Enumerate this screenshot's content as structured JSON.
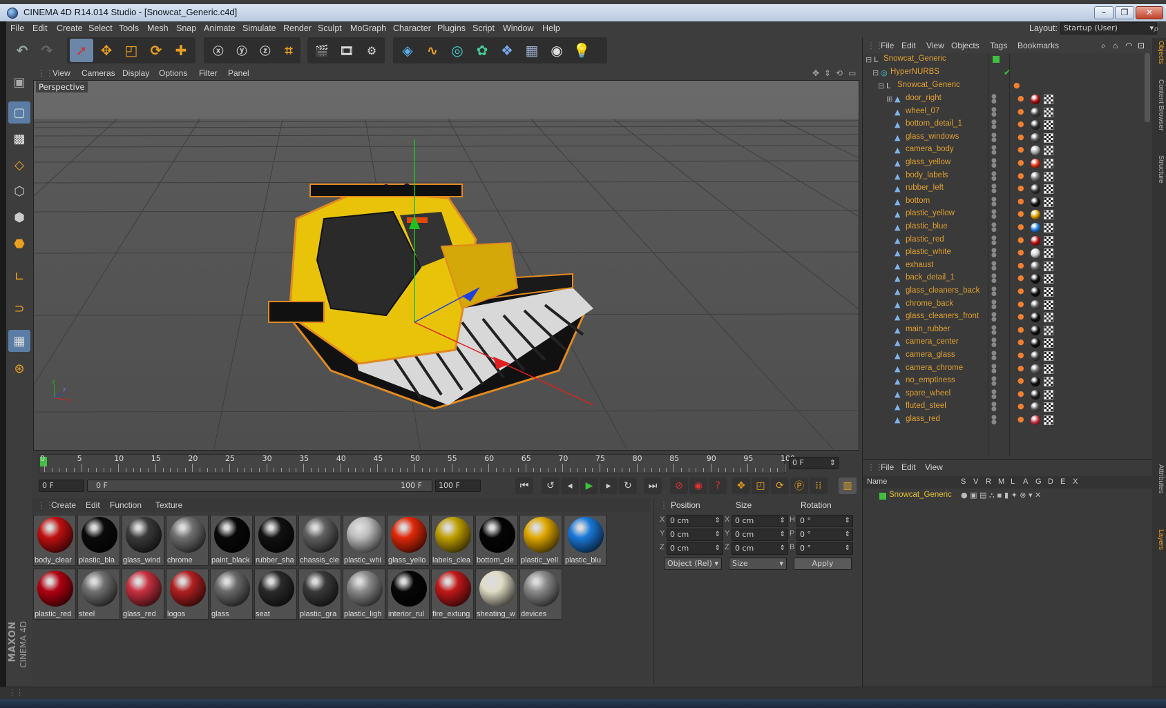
{
  "window": {
    "title": "CINEMA 4D R14.014 Studio - [Snowcat_Generic.c4d]",
    "min": "–",
    "max": "❐",
    "close": "✕"
  },
  "menu": [
    "File",
    "Edit",
    "Create",
    "Select",
    "Tools",
    "Mesh",
    "Snap",
    "Animate",
    "Simulate",
    "Render",
    "Sculpt",
    "MoGraph",
    "Character",
    "Plugins",
    "Script",
    "Window",
    "Help"
  ],
  "layout": {
    "label": "Layout:",
    "value": "Startup (User)"
  },
  "viewport": {
    "menu": [
      "View",
      "Cameras",
      "Display",
      "Options",
      "Filter",
      "Panel"
    ],
    "label": "Perspective"
  },
  "timeline": {
    "ticks": [
      "0",
      "5",
      "10",
      "15",
      "20",
      "25",
      "30",
      "35",
      "40",
      "45",
      "50",
      "55",
      "60",
      "65",
      "70",
      "75",
      "80",
      "85",
      "90",
      "95",
      "100"
    ],
    "current": "0 F",
    "start": "0 F",
    "range_start": "0 F",
    "range_end": "100 F",
    "end": "100 F"
  },
  "materials": {
    "menu": [
      "Create",
      "Edit",
      "Function",
      "Texture"
    ],
    "row1": [
      {
        "name": "body_clear",
        "color": "#c01010"
      },
      {
        "name": "plastic_bla",
        "color": "#0a0a0a"
      },
      {
        "name": "glass_wind",
        "color": "#3a3a3a"
      },
      {
        "name": "chrome",
        "color": "#707070"
      },
      {
        "name": "paint_black",
        "color": "#080808"
      },
      {
        "name": "rubber_sha",
        "color": "#111111"
      },
      {
        "name": "chassis_cle",
        "color": "#606060"
      },
      {
        "name": "plastic_whi",
        "color": "#bdbdbd"
      },
      {
        "name": "glass_yello",
        "color": "#e02808"
      },
      {
        "name": "labels_clea",
        "color": "#c0a000"
      },
      {
        "name": "bottom_cle",
        "color": "#050505"
      },
      {
        "name": "plastic_yell",
        "color": "#e0a800"
      },
      {
        "name": "plastic_blu",
        "color": "#1a78d8"
      }
    ],
    "row2": [
      {
        "name": "plastic_red",
        "color": "#b00010"
      },
      {
        "name": "steel",
        "color": "#707070"
      },
      {
        "name": "glass_red",
        "color": "#c83040"
      },
      {
        "name": "logos",
        "color": "#b02020"
      },
      {
        "name": "glass",
        "color": "#6a6a6a"
      },
      {
        "name": "seat",
        "color": "#2a2a2a"
      },
      {
        "name": "plastic_gra",
        "color": "#3a3a3a"
      },
      {
        "name": "plastic_ligh",
        "color": "#8a8a8a"
      },
      {
        "name": "interior_rul",
        "color": "#060606"
      },
      {
        "name": "fire_extung",
        "color": "#c01818"
      },
      {
        "name": "sheating_w",
        "color": "#e0dcc4"
      },
      {
        "name": "devices",
        "color": "#8a8a8a"
      }
    ]
  },
  "coords": {
    "headers": [
      "Position",
      "Size",
      "Rotation"
    ],
    "rows": [
      {
        "a": "X",
        "pos": "0 cm",
        "b": "X",
        "size": "0 cm",
        "c": "H",
        "rot": "0 °"
      },
      {
        "a": "Y",
        "pos": "0 cm",
        "b": "Y",
        "size": "0 cm",
        "c": "P",
        "rot": "0 °"
      },
      {
        "a": "Z",
        "pos": "0 cm",
        "b": "Z",
        "size": "0 cm",
        "c": "B",
        "rot": "0 °"
      }
    ],
    "mode": "Object (Rel)",
    "size_mode": "Size",
    "apply": "Apply"
  },
  "objects": {
    "menu": [
      "File",
      "Edit",
      "View",
      "Objects",
      "Tags",
      "Bookmarks"
    ],
    "root": "Snowcat_Generic",
    "hypernurbs": "HyperNURBS",
    "group": "Snowcat_Generic",
    "items": [
      {
        "name": "door_right",
        "tag": "#b01010"
      },
      {
        "name": "wheel_07",
        "tag": "#444444"
      },
      {
        "name": "bottom_detail_1",
        "tag": "#333333"
      },
      {
        "name": "glass_windows",
        "tag": "#555555"
      },
      {
        "name": "camera_body",
        "tag": "#aaaaaa"
      },
      {
        "name": "glass_yellow",
        "tag": "#e03010"
      },
      {
        "name": "body_labels",
        "tag": "#777777"
      },
      {
        "name": "rubber_left",
        "tag": "#333333"
      },
      {
        "name": "bottom",
        "tag": "#111111"
      },
      {
        "name": "plastic_yellow",
        "tag": "#e0a000"
      },
      {
        "name": "plastic_blue",
        "tag": "#2080e0"
      },
      {
        "name": "plastic_red",
        "tag": "#c01010"
      },
      {
        "name": "plastic_white",
        "tag": "#cccccc"
      },
      {
        "name": "exhaust",
        "tag": "#666666"
      },
      {
        "name": "back_detail_1",
        "tag": "#111111"
      },
      {
        "name": "glass_cleaners_back",
        "tag": "#111111"
      },
      {
        "name": "chrome_back",
        "tag": "#555555"
      },
      {
        "name": "glass_cleaners_front",
        "tag": "#111111"
      },
      {
        "name": "main_rubber",
        "tag": "#111111"
      },
      {
        "name": "camera_center",
        "tag": "#111111"
      },
      {
        "name": "camera_glass",
        "tag": "#444444"
      },
      {
        "name": "camera_chrome",
        "tag": "#666666"
      },
      {
        "name": "no_emptiness",
        "tag": "#111111"
      },
      {
        "name": "spare_wheel",
        "tag": "#222222"
      },
      {
        "name": "fluted_steel",
        "tag": "#555555"
      },
      {
        "name": "glass_red",
        "tag": "#d03040"
      }
    ]
  },
  "layers": {
    "menu": [
      "File",
      "Edit",
      "View"
    ],
    "columns": [
      "Name",
      "S",
      "V",
      "R",
      "M",
      "L",
      "A",
      "G",
      "D",
      "E",
      "X"
    ],
    "row": "Snowcat_Generic"
  },
  "side_tabs": [
    "Objects",
    "Content Browser",
    "Structure",
    "Attributes",
    "Layers"
  ],
  "logo": {
    "brand": "MAXON",
    "product": "CINEMA 4D"
  }
}
